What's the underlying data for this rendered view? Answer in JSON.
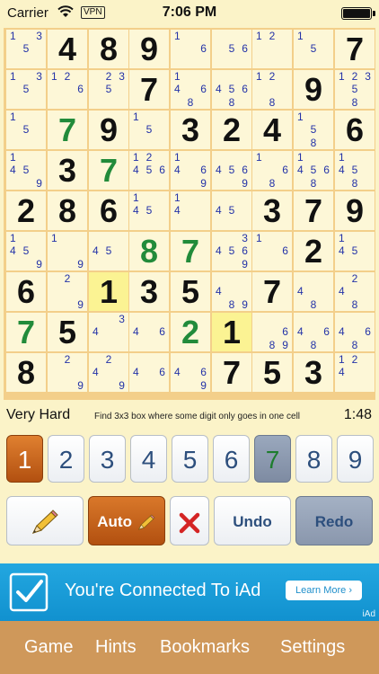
{
  "status_bar": {
    "carrier": "Carrier",
    "vpn": "VPN",
    "time": "7:06 PM"
  },
  "board": {
    "highlighted": [
      [
        6,
        2
      ],
      [
        7,
        5
      ]
    ],
    "cells": [
      [
        {
          "n": [
            "1",
            "5",
            "3"
          ]
        },
        {
          "v": "4"
        },
        {
          "v": "8"
        },
        {
          "v": "9"
        },
        {
          "n": [
            "1",
            "6"
          ]
        },
        {
          "n": [
            "5",
            "6"
          ]
        },
        {
          "n": [
            "1",
            "2"
          ]
        },
        {
          "n": [
            "1",
            "5"
          ]
        },
        {
          "v": "7"
        }
      ],
      [
        {
          "n": [
            "1",
            "5",
            "3"
          ]
        },
        {
          "n": [
            "1",
            "2",
            "6"
          ]
        },
        {
          "n": [
            "2",
            "3",
            "5"
          ]
        },
        {
          "v": "7"
        },
        {
          "n": [
            "1",
            "4",
            "6",
            "8"
          ]
        },
        {
          "n": [
            "4",
            "5",
            "6",
            "8"
          ]
        },
        {
          "n": [
            "1",
            "2",
            "8"
          ]
        },
        {
          "v": "9"
        },
        {
          "n": [
            "1",
            "2",
            "3",
            "5",
            "8"
          ]
        }
      ],
      [
        {
          "n": [
            "1",
            "5"
          ]
        },
        {
          "v": "7",
          "g": 1
        },
        {
          "v": "9"
        },
        {
          "n": [
            "1",
            "5"
          ]
        },
        {
          "v": "3"
        },
        {
          "v": "2"
        },
        {
          "v": "4"
        },
        {
          "n": [
            "1",
            "5",
            "8"
          ]
        },
        {
          "v": "6"
        }
      ],
      [
        {
          "n": [
            "1",
            "4",
            "5",
            "9"
          ]
        },
        {
          "v": "3"
        },
        {
          "v": "7",
          "g": 1
        },
        {
          "n": [
            "1",
            "2",
            "4",
            "5",
            "6"
          ]
        },
        {
          "n": [
            "1",
            "4",
            "6",
            "9"
          ]
        },
        {
          "n": [
            "4",
            "5",
            "6",
            "9"
          ]
        },
        {
          "n": [
            "1",
            "6",
            "8"
          ]
        },
        {
          "n": [
            "1",
            "4",
            "5",
            "6",
            "8"
          ]
        },
        {
          "n": [
            "1",
            "4",
            "5",
            "8"
          ]
        }
      ],
      [
        {
          "v": "2"
        },
        {
          "v": "8"
        },
        {
          "v": "6"
        },
        {
          "n": [
            "1",
            "4",
            "5"
          ]
        },
        {
          "n": [
            "1",
            "4"
          ]
        },
        {
          "n": [
            "4",
            "5"
          ]
        },
        {
          "v": "3"
        },
        {
          "v": "7"
        },
        {
          "v": "9"
        }
      ],
      [
        {
          "n": [
            "1",
            "4",
            "5",
            "9"
          ]
        },
        {
          "n": [
            "1",
            "9"
          ]
        },
        {
          "n": [
            "4",
            "5"
          ]
        },
        {
          "v": "8",
          "g": 1
        },
        {
          "v": "7",
          "g": 1
        },
        {
          "n": [
            "3",
            "4",
            "5",
            "6",
            "9"
          ]
        },
        {
          "n": [
            "1",
            "6"
          ]
        },
        {
          "v": "2"
        },
        {
          "n": [
            "1",
            "4",
            "5"
          ]
        }
      ],
      [
        {
          "v": "6"
        },
        {
          "n": [
            "2",
            "9"
          ]
        },
        {
          "v": "1"
        },
        {
          "v": "3"
        },
        {
          "v": "5"
        },
        {
          "n": [
            "4",
            "8",
            "9"
          ]
        },
        {
          "v": "7"
        },
        {
          "n": [
            "4",
            "8"
          ]
        },
        {
          "n": [
            "2",
            "4",
            "8"
          ]
        }
      ],
      [
        {
          "v": "7",
          "g": 1
        },
        {
          "v": "5"
        },
        {
          "n": [
            "3",
            "4"
          ]
        },
        {
          "n": [
            "4",
            "6"
          ]
        },
        {
          "v": "2",
          "g": 1
        },
        {
          "v": "1"
        },
        {
          "n": [
            "6",
            "8",
            "9"
          ]
        },
        {
          "n": [
            "4",
            "6",
            "8"
          ]
        },
        {
          "n": [
            "4",
            "6",
            "8"
          ]
        }
      ],
      [
        {
          "v": "8"
        },
        {
          "n": [
            "2",
            "9"
          ]
        },
        {
          "n": [
            "2",
            "4",
            "9"
          ]
        },
        {
          "n": [
            "4",
            "6"
          ]
        },
        {
          "n": [
            "4",
            "6",
            "9"
          ]
        },
        {
          "v": "7"
        },
        {
          "v": "5"
        },
        {
          "v": "3"
        },
        {
          "n": [
            "1",
            "2",
            "4"
          ]
        }
      ]
    ]
  },
  "info": {
    "level": "Very Hard",
    "hint": "Find 3x3 box where some digit only goes in one cell",
    "timer": "1:48"
  },
  "digits": [
    {
      "label": "1",
      "state": "selected"
    },
    {
      "label": "2",
      "state": "normal"
    },
    {
      "label": "3",
      "state": "normal"
    },
    {
      "label": "4",
      "state": "normal"
    },
    {
      "label": "5",
      "state": "normal"
    },
    {
      "label": "6",
      "state": "normal"
    },
    {
      "label": "7",
      "state": "completed"
    },
    {
      "label": "8",
      "state": "normal"
    },
    {
      "label": "9",
      "state": "normal"
    }
  ],
  "actions": {
    "pencil_icon": "pencil-icon",
    "auto_label": "Auto",
    "erase_icon": "x-icon",
    "undo_label": "Undo",
    "redo_label": "Redo"
  },
  "ad": {
    "text": "You're Connected To iAd",
    "button": "Learn More",
    "tag": "iAd"
  },
  "tabs": [
    "Game",
    "Hints",
    "Bookmarks",
    "Settings"
  ],
  "colors": {
    "accent_orange": "#c96617",
    "given_green": "#228b3a",
    "note_blue": "#2332a8",
    "board_border": "#f3cf8a",
    "highlight": "#fbf393",
    "tab_bar": "#cf985a"
  }
}
